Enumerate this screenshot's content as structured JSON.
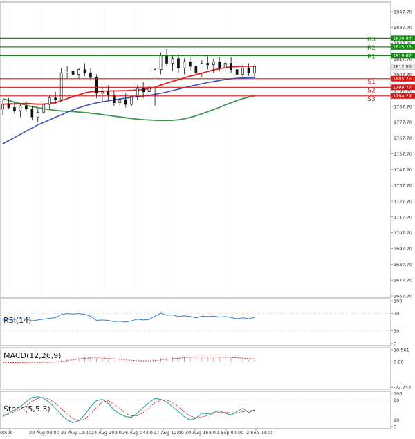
{
  "chart_data": [
    {
      "type": "candlestick",
      "ylim": [
        1667.7,
        1852.0
      ],
      "y_ticks": [
        1847.7,
        1837.7,
        1827.7,
        1817.7,
        1807.7,
        1797.7,
        1787.7,
        1777.7,
        1767.7,
        1757.7,
        1747.7,
        1737.7,
        1727.7,
        1717.7,
        1707.7,
        1697.7,
        1687.7,
        1677.7,
        1667.7
      ],
      "x_ticks": [
        "00:00",
        "20 Aug 08:00",
        "23 Aug 12:00",
        "24 Aug 20:00",
        "26 Aug 04:00",
        "27 Aug 12:00",
        "30 Aug 16:00",
        "1 Sep 00:00",
        "2 Sep 08:00"
      ],
      "current_price": 1812.86,
      "levels": [
        {
          "name": "R3",
          "value": 1830.83,
          "color": "#1a8a1a"
        },
        {
          "name": "R2",
          "value": 1825.35,
          "color": "#1a8a1a"
        },
        {
          "name": "R1",
          "value": 1819.87,
          "color": "#1a8a1a"
        },
        {
          "name": "S1",
          "value": 1805.25,
          "color": "#d41c1c"
        },
        {
          "name": "S2",
          "value": 1799.77,
          "color": "#d41c1c"
        },
        {
          "name": "S3",
          "value": 1794.29,
          "color": "#d41c1c"
        }
      ],
      "level_values_text": [
        "1830.83",
        "1825.35",
        "1819.87",
        "1805.25",
        "1799.77",
        "1794.29"
      ],
      "current_price_text": "1812.86",
      "candles": [
        {
          "o": 1786,
          "h": 1792,
          "l": 1782,
          "c": 1789
        },
        {
          "o": 1789,
          "h": 1793,
          "l": 1786,
          "c": 1787
        },
        {
          "o": 1787,
          "h": 1790,
          "l": 1783,
          "c": 1785
        },
        {
          "o": 1785,
          "h": 1789,
          "l": 1781,
          "c": 1788
        },
        {
          "o": 1788,
          "h": 1791,
          "l": 1784,
          "c": 1786
        },
        {
          "o": 1786,
          "h": 1788,
          "l": 1779,
          "c": 1781
        },
        {
          "o": 1781,
          "h": 1786,
          "l": 1778,
          "c": 1784
        },
        {
          "o": 1784,
          "h": 1791,
          "l": 1782,
          "c": 1789
        },
        {
          "o": 1789,
          "h": 1795,
          "l": 1786,
          "c": 1793
        },
        {
          "o": 1793,
          "h": 1797,
          "l": 1789,
          "c": 1792
        },
        {
          "o": 1792,
          "h": 1812,
          "l": 1791,
          "c": 1809
        },
        {
          "o": 1809,
          "h": 1813,
          "l": 1805,
          "c": 1810
        },
        {
          "o": 1810,
          "h": 1813,
          "l": 1806,
          "c": 1808
        },
        {
          "o": 1808,
          "h": 1812,
          "l": 1805,
          "c": 1811
        },
        {
          "o": 1811,
          "h": 1815,
          "l": 1807,
          "c": 1809
        },
        {
          "o": 1809,
          "h": 1812,
          "l": 1804,
          "c": 1806
        },
        {
          "o": 1806,
          "h": 1808,
          "l": 1793,
          "c": 1796
        },
        {
          "o": 1796,
          "h": 1800,
          "l": 1790,
          "c": 1797
        },
        {
          "o": 1797,
          "h": 1801,
          "l": 1792,
          "c": 1795
        },
        {
          "o": 1795,
          "h": 1798,
          "l": 1788,
          "c": 1790
        },
        {
          "o": 1790,
          "h": 1794,
          "l": 1786,
          "c": 1792
        },
        {
          "o": 1792,
          "h": 1796,
          "l": 1787,
          "c": 1789
        },
        {
          "o": 1789,
          "h": 1795,
          "l": 1788,
          "c": 1794
        },
        {
          "o": 1794,
          "h": 1801,
          "l": 1792,
          "c": 1799
        },
        {
          "o": 1799,
          "h": 1803,
          "l": 1793,
          "c": 1797
        },
        {
          "o": 1797,
          "h": 1802,
          "l": 1795,
          "c": 1800
        },
        {
          "o": 1800,
          "h": 1812,
          "l": 1788,
          "c": 1811
        },
        {
          "o": 1811,
          "h": 1822,
          "l": 1808,
          "c": 1820
        },
        {
          "o": 1820,
          "h": 1824,
          "l": 1813,
          "c": 1815
        },
        {
          "o": 1815,
          "h": 1820,
          "l": 1810,
          "c": 1818
        },
        {
          "o": 1818,
          "h": 1821,
          "l": 1809,
          "c": 1812
        },
        {
          "o": 1812,
          "h": 1818,
          "l": 1808,
          "c": 1816
        },
        {
          "o": 1816,
          "h": 1820,
          "l": 1810,
          "c": 1813
        },
        {
          "o": 1813,
          "h": 1817,
          "l": 1807,
          "c": 1809
        },
        {
          "o": 1809,
          "h": 1817,
          "l": 1806,
          "c": 1815
        },
        {
          "o": 1815,
          "h": 1820,
          "l": 1811,
          "c": 1814
        },
        {
          "o": 1814,
          "h": 1818,
          "l": 1809,
          "c": 1816
        },
        {
          "o": 1816,
          "h": 1819,
          "l": 1810,
          "c": 1812
        },
        {
          "o": 1812,
          "h": 1817,
          "l": 1808,
          "c": 1815
        },
        {
          "o": 1815,
          "h": 1819,
          "l": 1809,
          "c": 1811
        },
        {
          "o": 1811,
          "h": 1816,
          "l": 1806,
          "c": 1808
        },
        {
          "o": 1808,
          "h": 1814,
          "l": 1806,
          "c": 1812
        },
        {
          "o": 1812,
          "h": 1815,
          "l": 1807,
          "c": 1809
        },
        {
          "o": 1809,
          "h": 1814,
          "l": 1806,
          "c": 1813
        }
      ],
      "ma_red": [
        1789,
        1789.3,
        1789.3,
        1789.5,
        1789.6,
        1789.3,
        1789.1,
        1789.2,
        1789.6,
        1790,
        1791.3,
        1792.6,
        1793.8,
        1795,
        1796.2,
        1797,
        1797,
        1797.3,
        1797.5,
        1797.5,
        1797.6,
        1797.6,
        1797.8,
        1798.1,
        1798.4,
        1798.8,
        1799.8,
        1801.2,
        1802.4,
        1803.6,
        1804.6,
        1805.8,
        1806.9,
        1807.8,
        1808.8,
        1809.8,
        1810.8,
        1811.5,
        1812.2,
        1812.7,
        1812.9,
        1813.1,
        1813.1,
        1813.1
      ],
      "ma_blue": [
        1764,
        1766,
        1768,
        1770,
        1772,
        1774,
        1776,
        1777.6,
        1779.2,
        1780.8,
        1782.4,
        1784,
        1785.5,
        1786.8,
        1788,
        1789,
        1789.9,
        1790.6,
        1791.2,
        1791.8,
        1792.4,
        1792.9,
        1793.4,
        1793.8,
        1794.2,
        1794.7,
        1795.3,
        1796,
        1796.8,
        1797.7,
        1798.6,
        1799.5,
        1800.4,
        1801.2,
        1802,
        1802.8,
        1803.5,
        1804.1,
        1804.7,
        1805.2,
        1805.5,
        1805.7,
        1805.9,
        1806
      ],
      "ma_green": [
        1792.5,
        1791.5,
        1790.4,
        1789.4,
        1788.5,
        1787.6,
        1786.9,
        1786.3,
        1785.7,
        1785.2,
        1784.8,
        1784.6,
        1784.4,
        1784.1,
        1783.8,
        1783.4,
        1783,
        1782.5,
        1782,
        1781.5,
        1781,
        1780.5,
        1780,
        1779.6,
        1779.3,
        1779.1,
        1778.9,
        1778.8,
        1778.8,
        1778.9,
        1779.2,
        1779.8,
        1780.7,
        1781.8,
        1783,
        1784.3,
        1785.7,
        1787.1,
        1788.6,
        1790,
        1791.4,
        1792.6,
        1793.6,
        1794.4
      ]
    },
    {
      "type": "line",
      "name": "RSI(14)",
      "ylim": [
        0,
        100
      ],
      "y_ticks_text": [
        "100",
        "70",
        "30",
        "0"
      ],
      "y_ticks": [
        100,
        70,
        30,
        0
      ],
      "values": [
        55,
        57,
        56,
        58,
        57,
        53,
        55,
        57,
        59,
        60,
        68,
        70,
        69,
        70,
        68,
        64,
        54,
        55,
        54,
        51,
        52,
        50,
        53,
        57,
        55,
        56,
        64,
        71,
        66,
        67,
        63,
        65,
        63,
        60,
        64,
        63,
        64,
        62,
        63,
        61,
        58,
        60,
        58,
        61
      ]
    },
    {
      "type": "histogram",
      "name": "MACD(12,26,9)",
      "ylim": [
        -22.753,
        10.561
      ],
      "y_ticks_text": [
        "10.561",
        "0.00",
        "-22.753"
      ],
      "y_ticks": [
        10.561,
        0,
        -22.753
      ],
      "hist": [
        -0.5,
        -0.6,
        -0.7,
        -0.6,
        -0.5,
        -0.7,
        -0.8,
        -0.5,
        -0.2,
        0.3,
        1.5,
        2.8,
        3.5,
        4.0,
        4.2,
        4.0,
        3.0,
        2.2,
        1.6,
        0.9,
        0.4,
        -0.1,
        -0.3,
        -0.1,
        0.3,
        0.6,
        1.8,
        3.2,
        4.0,
        4.3,
        4.2,
        4.4,
        4.5,
        4.2,
        4.3,
        4.1,
        4.0,
        3.7,
        3.5,
        3.0,
        2.4,
        2.0,
        1.5,
        1.2
      ],
      "signal": [
        -0.8,
        -0.8,
        -0.8,
        -0.7,
        -0.7,
        -0.7,
        -0.7,
        -0.6,
        -0.5,
        -0.3,
        0.2,
        0.9,
        1.6,
        2.3,
        2.9,
        3.3,
        3.3,
        3.1,
        2.8,
        2.4,
        2.0,
        1.5,
        1.1,
        0.8,
        0.6,
        0.6,
        0.9,
        1.4,
        2.0,
        2.6,
        3.0,
        3.4,
        3.7,
        3.9,
        4.0,
        4.0,
        4.0,
        3.9,
        3.8,
        3.6,
        3.4,
        3.1,
        2.8,
        2.5
      ]
    },
    {
      "type": "line",
      "name": "Stoch(5,5,3)",
      "ylim": [
        0,
        100
      ],
      "y_ticks_text": [
        "100",
        "80",
        "20",
        "0"
      ],
      "y_ticks": [
        100,
        80,
        20,
        0
      ],
      "k": [
        30,
        40,
        50,
        60,
        75,
        88,
        90,
        85,
        72,
        55,
        35,
        20,
        12,
        18,
        35,
        60,
        78,
        82,
        70,
        50,
        38,
        30,
        28,
        40,
        58,
        72,
        85,
        82,
        74,
        60,
        45,
        30,
        20,
        25,
        40,
        38,
        42,
        48,
        40,
        35,
        45,
        55,
        42,
        50
      ],
      "d": [
        35,
        38,
        45,
        52,
        64,
        76,
        85,
        88,
        82,
        70,
        54,
        38,
        24,
        18,
        22,
        38,
        57,
        74,
        78,
        68,
        54,
        40,
        32,
        33,
        42,
        57,
        72,
        80,
        80,
        72,
        60,
        44,
        32,
        26,
        29,
        34,
        40,
        43,
        43,
        41,
        40,
        45,
        47,
        49
      ]
    }
  ]
}
